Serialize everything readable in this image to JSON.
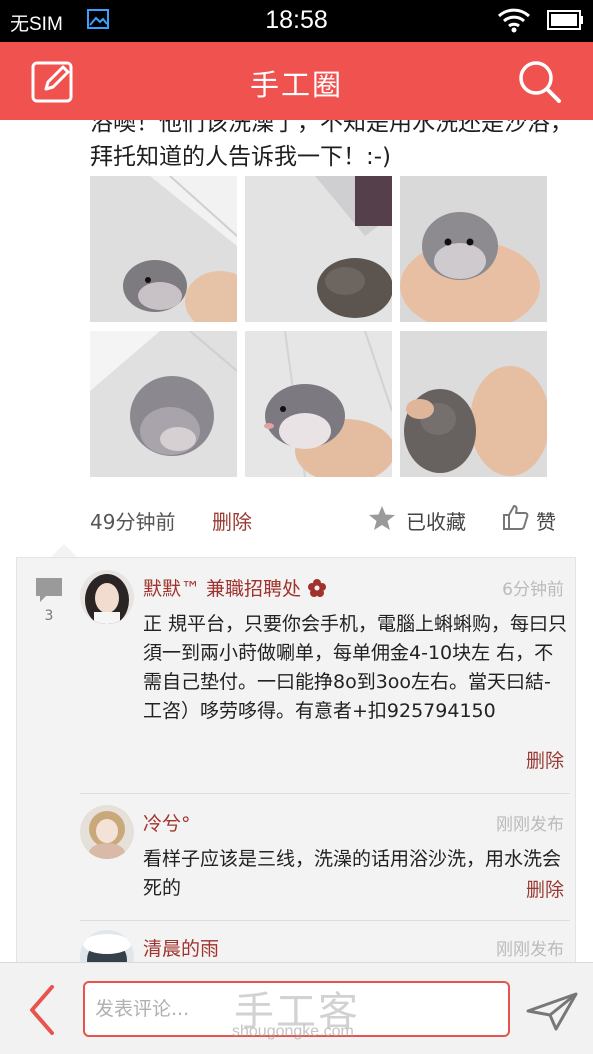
{
  "status_bar": {
    "carrier": "无SIM",
    "time": "18:58"
  },
  "header": {
    "title": "手工圈",
    "edit_icon": "edit-icon",
    "search_icon": "search-icon"
  },
  "post": {
    "text": "浴噢！他们该洗澡了，不知是用水洗还是沙浴，拜托知道的人告诉我一下！:-)",
    "photos": [
      "hamster photo",
      "hamster photo",
      "hamster photo",
      "hamster photo",
      "hamster photo",
      "hamster photo"
    ],
    "time_ago": "49分钟前",
    "delete_label": "删除",
    "favorite_label": "已收藏",
    "like_label": "赞"
  },
  "comments_panel": {
    "count": "3",
    "items": [
      {
        "name": "默默™  兼職招聘处",
        "time": "6分钟前",
        "text": "正 規平台，只要你会手机，電腦上蝌蝌购，每曰只須一到兩小莳做唰单，每单佣金4-10块左  右，不需自己垫付。一曰能挣8o到3oo左右。當天曰結-工咨）哆劳哆得。有意者+扣925794150",
        "delete_label": "删除"
      },
      {
        "name": "冷兮°",
        "time": "刚刚发布",
        "text": "看样子应该是三线，洗澡的话用浴沙洗，用水洗会死的",
        "delete_label": "删除"
      },
      {
        "name": "清晨的雨",
        "time": "刚刚发布"
      }
    ]
  },
  "bottom_bar": {
    "placeholder": "发表评论...",
    "watermark": "手工客",
    "watermark_url": "shougongke.com"
  },
  "colors": {
    "accent": "#f0524f",
    "link": "#9a3a34"
  }
}
